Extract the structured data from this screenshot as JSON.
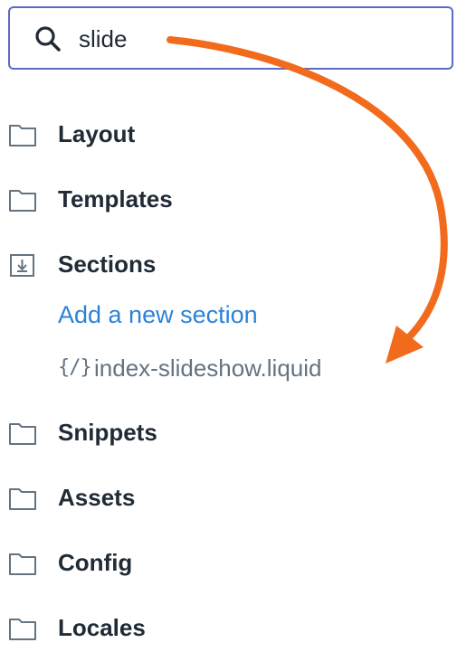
{
  "search": {
    "value": "slide",
    "icon": "search-icon",
    "focus_color": "#5c6ac4"
  },
  "tree": {
    "folders_before": [
      {
        "label": "Layout",
        "icon": "folder-icon"
      },
      {
        "label": "Templates",
        "icon": "folder-icon"
      }
    ],
    "sections": {
      "label": "Sections",
      "icon": "folder-open-icon",
      "add_link": "Add a new section",
      "files": [
        {
          "icon_text": "{/}",
          "name": "index-slideshow.liquid"
        }
      ]
    },
    "folders_after": [
      {
        "label": "Snippets",
        "icon": "folder-icon"
      },
      {
        "label": "Assets",
        "icon": "folder-icon"
      },
      {
        "label": "Config",
        "icon": "folder-icon"
      },
      {
        "label": "Locales",
        "icon": "folder-icon"
      }
    ]
  },
  "colors": {
    "text": "#212b36",
    "link": "#2c83d6",
    "muted": "#637381",
    "annotation_arrow": "#f26b1d"
  }
}
